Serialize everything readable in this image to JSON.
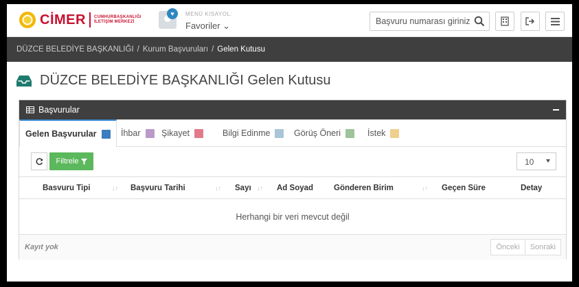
{
  "header": {
    "logo_text": "CİMER",
    "logo_subtext": [
      "CUMHURBAŞKANLIĞI",
      "İLETİŞİM MERKEZİ"
    ],
    "favorites_label": "MENÜ KISAYOL:",
    "favorites_value": "Favoriler ⌄",
    "search_placeholder": "Başvuru numarası giriniz"
  },
  "breadcrumb": {
    "items": [
      "DÜZCE BELEDİYE BAŞKANLIĞI",
      "Kurum Başvuruları",
      "Gelen Kutusu"
    ],
    "separator": "/"
  },
  "page": {
    "title": "DÜZCE BELEDİYE BAŞKANLIĞI Gelen Kutusu"
  },
  "panel": {
    "title": "Başvurular",
    "tabs": [
      {
        "label": "Gelen Başvurular",
        "color": "#3b7dbf"
      },
      {
        "label": "İhbar",
        "color": "#b99ac9"
      },
      {
        "label": "Şikayet",
        "color": "#e27a8a"
      },
      {
        "label": "Bilgi Edinme",
        "color": "#a9c5d8"
      },
      {
        "label": "Görüş Öneri",
        "color": "#9dc49a"
      },
      {
        "label": "İstek",
        "color": "#efcf8e"
      }
    ],
    "filter_label": "Filtrele",
    "page_size": "10",
    "columns": [
      "Basvuru Tipi",
      "Başvuru Tarihi",
      "Sayı",
      "Ad Soyad",
      "Gönderen Birim",
      "Geçen Süre",
      "Detay"
    ],
    "empty_message": "Herhangi bir veri mevcut değil",
    "footer_info": "Kayıt yok",
    "prev_label": "Önceki",
    "next_label": "Sonraki"
  },
  "colors": {
    "dark_bar": "#3f3f3f",
    "filter_green": "#5cb85c",
    "brand_red": "#c8102e",
    "page_icon_teal": "#1f7a6e"
  }
}
